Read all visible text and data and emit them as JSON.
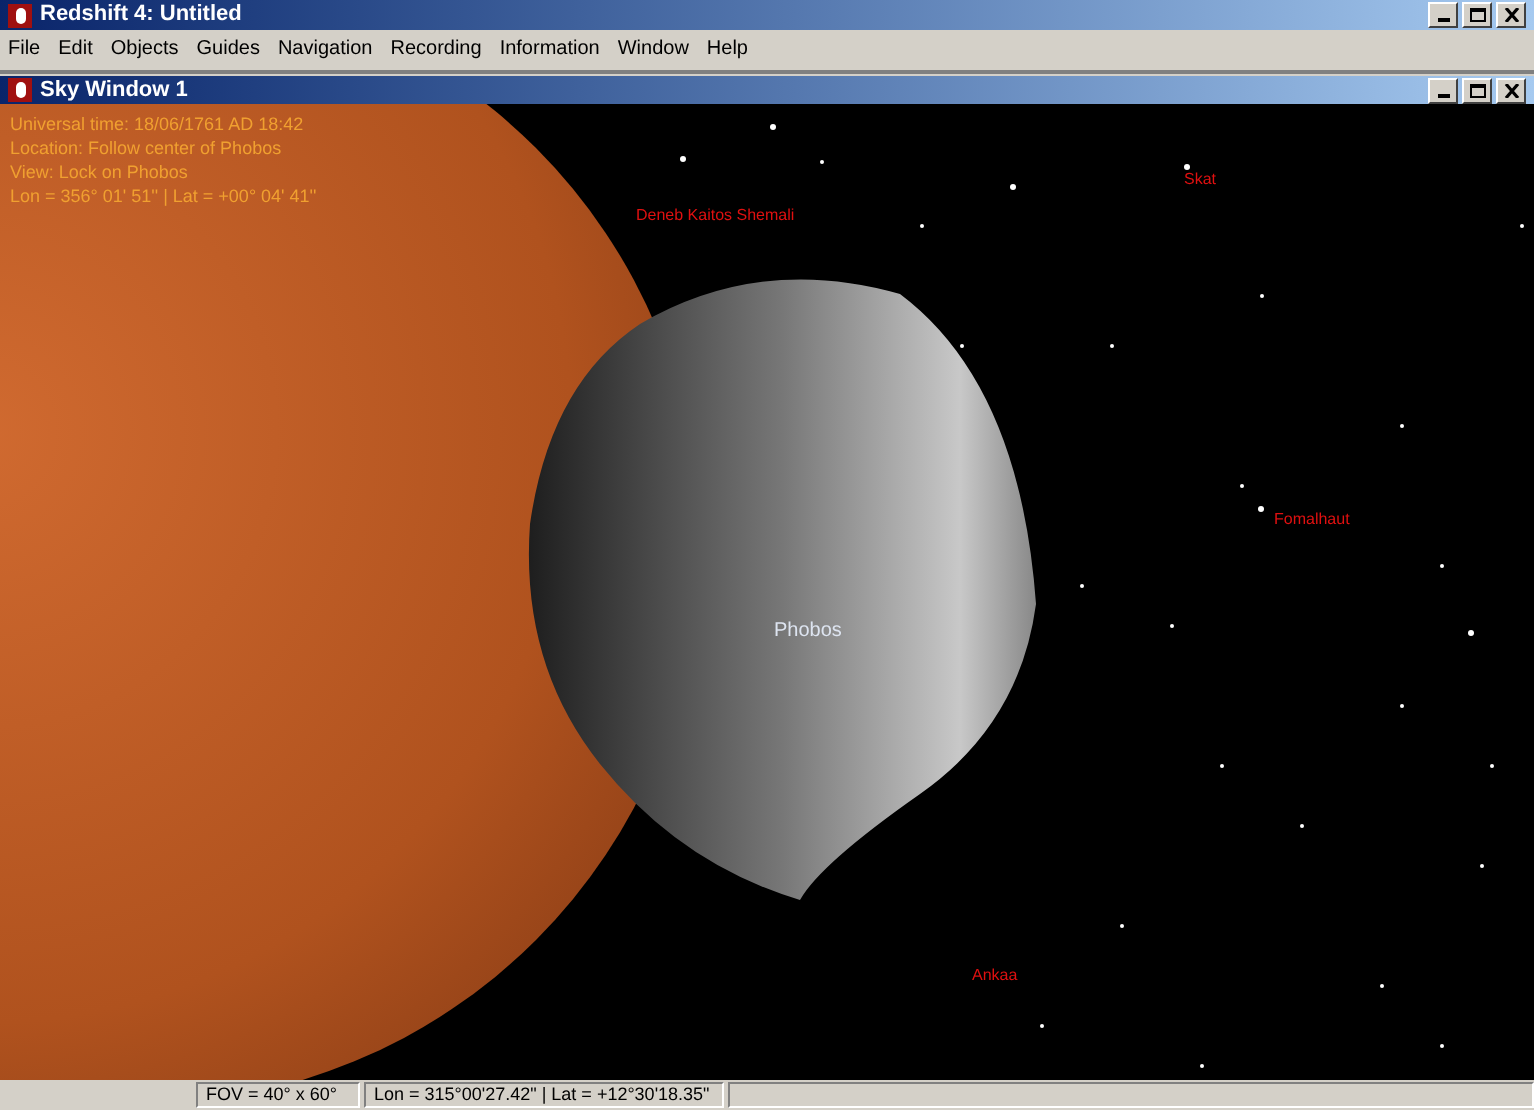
{
  "window": {
    "title": "Redshift 4: Untitled"
  },
  "menu": [
    "File",
    "Edit",
    "Objects",
    "Guides",
    "Navigation",
    "Recording",
    "Information",
    "Window",
    "Help"
  ],
  "sky_window": {
    "title": "Sky Window 1",
    "info_lines": [
      "Universal time: 18/06/1761 AD 18:42",
      "Location: Follow center of Phobos",
      "View: Lock on Phobos",
      "Lon = 356° 01' 51'' | Lat = +00° 04' 41''"
    ],
    "body_label": "Phobos",
    "star_labels": [
      {
        "text": "Deneb Kaitos Shemali"
      },
      {
        "text": "Skat"
      },
      {
        "text": "Fomalhaut"
      },
      {
        "text": "Ankaa"
      }
    ]
  },
  "status_bar": {
    "fov": "FOV = 40° x 60°",
    "position": "Lon = 315°00'27.42\" | Lat = +12°30'18.35\""
  }
}
